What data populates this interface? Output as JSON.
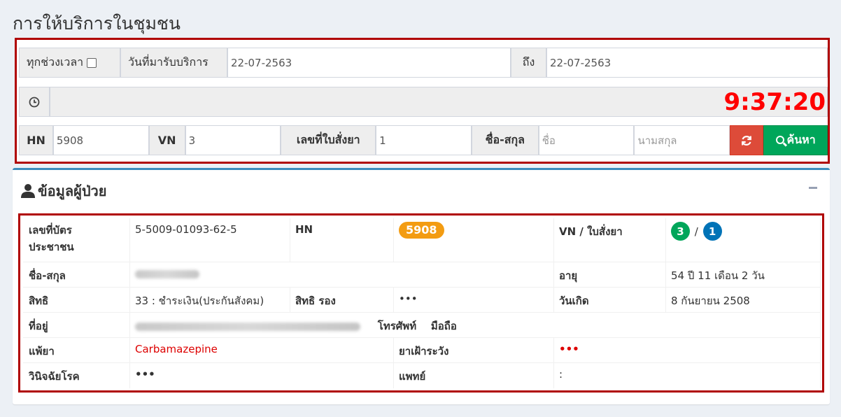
{
  "page": {
    "title": "การให้บริการในชุมชน"
  },
  "search": {
    "all_time_label": "ทุกช่วงเวลา",
    "service_date_label": "วันที่มารับบริการ",
    "date_from": "22-07-2563",
    "to_label": "ถึง",
    "date_to": "22-07-2563",
    "clock": "9:37:20",
    "hn_label": "HN",
    "hn_value": "5908",
    "vn_label": "VN",
    "vn_value": "3",
    "rx_no_label": "เลขที่ใบสั่งยา",
    "rx_no_value": "1",
    "name_label": "ชื่อ-สกุล",
    "first_name_placeholder": "ชื่อ",
    "last_name_placeholder": "นามสกุล",
    "search_button": "ค้นหา"
  },
  "patient": {
    "section_title": "ข้อมูลผู้ป่วย",
    "id_card_label": "เลขที่บัตรประชาชน",
    "id_card_line1": "เลขที่บัตร",
    "id_card_line2": "ประชาชน",
    "id_card_value": "5-5009-01093-62-5",
    "hn_label": "HN",
    "hn_value": "5908",
    "vn_rx_label": "VN / ใบสั่งยา",
    "vn_value": "3",
    "separator": "/",
    "rx_value": "1",
    "name_label": "ชื่อ-สกุล",
    "age_label": "อายุ",
    "age_value": "54 ปี 11 เดือน 2 วัน",
    "right_label": "สิทธิ",
    "right_value": "33 : ชำระเงิน(ประกันสังคม)",
    "secondary_right_label": "สิทธิ รอง",
    "secondary_right_value": "•••",
    "birth_label": "วันเกิด",
    "birth_value": "8 กันยายน 2508",
    "address_label": "ที่อยู่",
    "phone_label": "โทรศัพท์",
    "mobile_label": "มือถือ",
    "allergy_label": "แพ้ยา",
    "allergy_value": "Carbamazepine",
    "watch_drug_label": "ยาเฝ้าระวัง",
    "watch_drug_value": "•••",
    "diagnosis_label": "วินิจฉัยโรค",
    "diagnosis_value": "•••",
    "doctor_label": "แพทย์",
    "doctor_value": ":"
  },
  "colors": {
    "alert": "#ff0000",
    "frame": "#b00000",
    "search": "#00a65a",
    "refresh": "#dd4b39",
    "hn_badge": "#f39c12",
    "vn_badge": "#00a65a",
    "rx_badge": "#0073b7"
  },
  "icons": [
    "clock-icon",
    "refresh-icon",
    "search-icon",
    "user-icon",
    "collapse-icon"
  ]
}
